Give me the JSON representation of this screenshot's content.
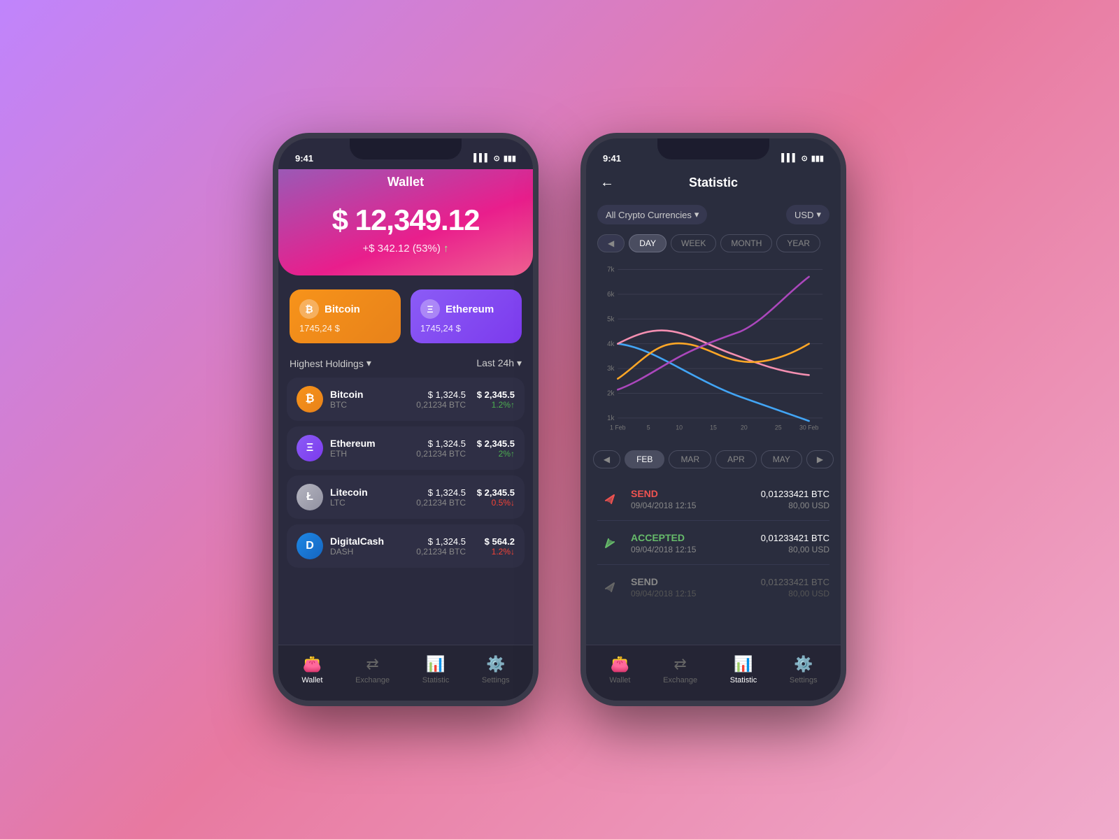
{
  "background": "#c084fc",
  "phone1": {
    "statusBar": {
      "time": "9:41",
      "icons": "▌▌ ⊙ ▮▮▮"
    },
    "title": "Wallet",
    "amount": "$ 12,349.12",
    "change": "+$ 342.12 (53%)",
    "changeArrow": "↑",
    "cards": [
      {
        "id": "bitcoin",
        "name": "Bitcoin",
        "value": "1745,24 $",
        "icon": "₿",
        "class": "bitcoin"
      },
      {
        "id": "ethereum",
        "name": "Ethereum",
        "value": "1745,24 $",
        "icon": "Ξ",
        "class": "ethereum"
      }
    ],
    "holdingsLabel": "Highest Holdings",
    "timeLabel": "Last 24h",
    "coins": [
      {
        "id": "btc",
        "name": "Bitcoin",
        "abbr": "BTC",
        "iconClass": "btc",
        "iconText": "₿",
        "price": "$ 1,324.5",
        "priceSub": "0,21234 BTC",
        "value": "$ 2,345.5",
        "changePct": "1.2%",
        "changeDir": "up"
      },
      {
        "id": "eth",
        "name": "Ethereum",
        "abbr": "ETH",
        "iconClass": "eth",
        "iconText": "Ξ",
        "price": "$ 1,324.5",
        "priceSub": "0,21234 BTC",
        "value": "$ 2,345.5",
        "changePct": "2%",
        "changeDir": "up"
      },
      {
        "id": "ltc",
        "name": "Litecoin",
        "abbr": "LTC",
        "iconClass": "ltc",
        "iconText": "Ł",
        "price": "$ 1,324.5",
        "priceSub": "0,21234 BTC",
        "value": "$ 2,345.5",
        "changePct": "0.5%",
        "changeDir": "down"
      },
      {
        "id": "dash",
        "name": "DigitalCash",
        "abbr": "DASH",
        "iconClass": "dash",
        "iconText": "D",
        "price": "$ 1,324.5",
        "priceSub": "0,21234 BTC",
        "value": "$ 564.2",
        "changePct": "1.2%",
        "changeDir": "down"
      }
    ],
    "nav": [
      {
        "id": "wallet",
        "icon": "👛",
        "label": "Wallet",
        "active": true
      },
      {
        "id": "exchange",
        "icon": "⇄",
        "label": "Exchange",
        "active": false
      },
      {
        "id": "statistic",
        "icon": "📊",
        "label": "Statistic",
        "active": false
      },
      {
        "id": "settings",
        "icon": "⚙️",
        "label": "Settings",
        "active": false
      }
    ]
  },
  "phone2": {
    "statusBar": {
      "time": "9:41",
      "icons": "▌▌ ⊙ ▮▮▮"
    },
    "title": "Statistic",
    "backLabel": "←",
    "filterCurrency": "All Crypto Currencies",
    "filterUnit": "USD",
    "timeTabs": [
      {
        "label": "DAY",
        "active": true
      },
      {
        "label": "WEEK",
        "active": false
      },
      {
        "label": "MONTH",
        "active": false
      },
      {
        "label": "YEAR",
        "active": false
      }
    ],
    "chartYLabels": [
      "7k",
      "6k",
      "5k",
      "4k",
      "3k",
      "2k",
      "1k"
    ],
    "chartXLabels": [
      "1 Feb",
      "5",
      "10",
      "15",
      "20",
      "25",
      "30 Feb"
    ],
    "monthTabs": [
      {
        "label": "FEB",
        "active": true
      },
      {
        "label": "MAR",
        "active": false
      },
      {
        "label": "APR",
        "active": false
      },
      {
        "label": "MAY",
        "active": false
      }
    ],
    "transactions": [
      {
        "id": "tx1",
        "type": "SEND",
        "typeClass": "send",
        "date": "09/04/2018 12:15",
        "crypto": "0,01233421 BTC",
        "usd": "80,00 USD",
        "iconColor": "#ef5350",
        "active": true
      },
      {
        "id": "tx2",
        "type": "ACCEPTED",
        "typeClass": "accepted",
        "date": "09/04/2018 12:15",
        "crypto": "0,01233421 BTC",
        "usd": "80,00 USD",
        "iconColor": "#66bb6a",
        "active": true
      },
      {
        "id": "tx3",
        "type": "SEND",
        "typeClass": "send-inactive",
        "date": "09/04/2018 12:15",
        "crypto": "0,01233421 BTC",
        "usd": "80,00 USD",
        "iconColor": "#666",
        "active": false
      }
    ],
    "nav": [
      {
        "id": "wallet",
        "icon": "👛",
        "label": "Wallet",
        "active": false
      },
      {
        "id": "exchange",
        "icon": "⇄",
        "label": "Exchange",
        "active": false
      },
      {
        "id": "statistic",
        "icon": "📊",
        "label": "Statistic",
        "active": true
      },
      {
        "id": "settings",
        "icon": "⚙️",
        "label": "Settings",
        "active": false
      }
    ]
  }
}
